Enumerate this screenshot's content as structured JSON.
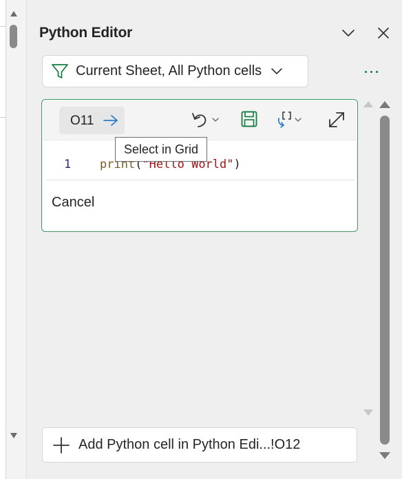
{
  "panel": {
    "title": "Python Editor",
    "collapse_icon": "chevron-down-icon",
    "close_icon": "close-icon"
  },
  "filter": {
    "icon": "filter-icon",
    "label": "Current Sheet, All Python cells",
    "more_icon": "more-options-icon"
  },
  "cell": {
    "reference": "O11",
    "toolbar_icons": [
      "arrow-right-icon",
      "undo-icon",
      "save-icon",
      "output-type-icon",
      "expand-icon"
    ],
    "code": {
      "line_number": "1",
      "keyword": "print",
      "open_paren": "(",
      "string": "\"Hello World\"",
      "close_paren": ")"
    },
    "cancel_label": "Cancel",
    "border_color": "#3f9a62"
  },
  "tooltip": {
    "text": "Select in Grid"
  },
  "add_cell": {
    "icon": "plus-icon",
    "label": "Add Python cell in Python Edi...!O12"
  },
  "colors": {
    "accent": "#107c41",
    "keyword": "#795e26",
    "string": "#a31515"
  }
}
